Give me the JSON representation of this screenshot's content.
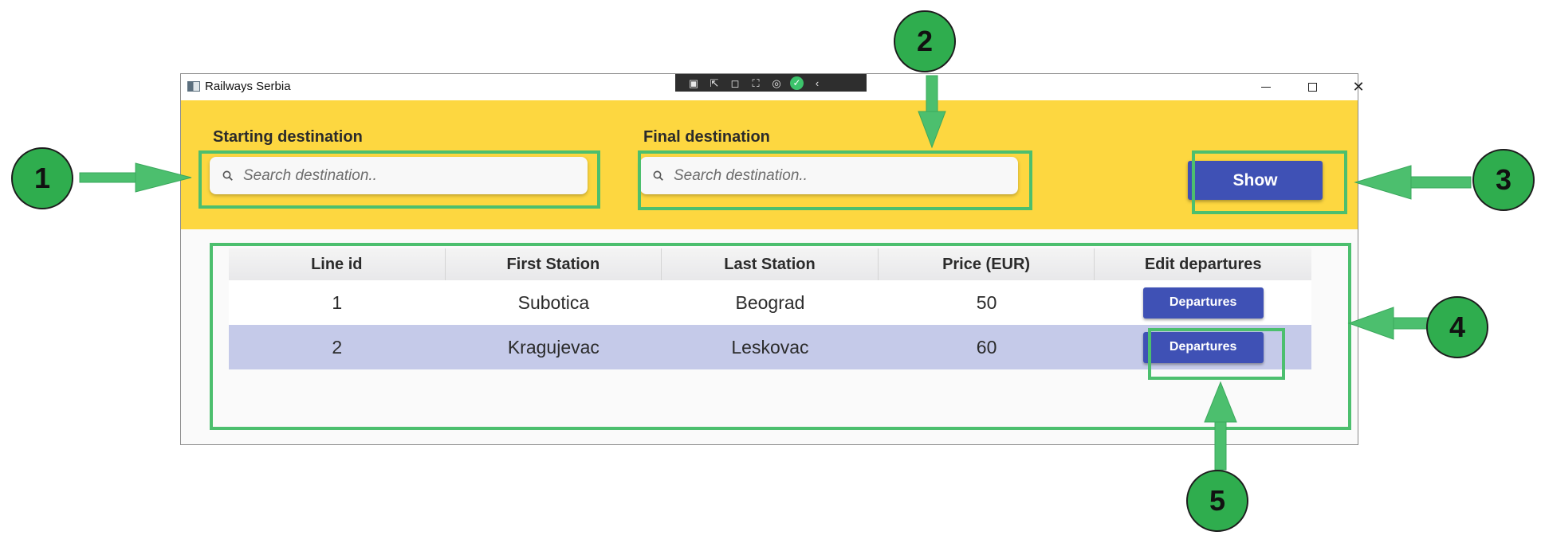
{
  "window": {
    "title": "Railways Serbia",
    "controls": {
      "minimize": "minimize",
      "maximize": "maximize",
      "close": "close"
    }
  },
  "devtools": {
    "icons": [
      "live-visual-tree-icon",
      "select-element-icon",
      "display-layout-adorners-icon",
      "track-focus-icon",
      "hot-reload-icon",
      "binding-ok-icon",
      "collapse-chevron-icon"
    ]
  },
  "header": {
    "starting_label": "Starting destination",
    "starting_placeholder": "Search destination..",
    "final_label": "Final destination",
    "final_placeholder": "Search destination..",
    "show_label": "Show"
  },
  "table": {
    "columns": [
      "Line id",
      "First Station",
      "Last Station",
      "Price (EUR)",
      "Edit departures"
    ],
    "rows": [
      {
        "id": "1",
        "first": "Subotica",
        "last": "Beograd",
        "price": "50",
        "action": "Departures"
      },
      {
        "id": "2",
        "first": "Kragujevac",
        "last": "Leskovac",
        "price": "60",
        "action": "Departures"
      }
    ]
  },
  "annotations": [
    "1",
    "2",
    "3",
    "4",
    "5"
  ],
  "colors": {
    "header_bg": "#fdd740",
    "primary_button": "#3f51b5",
    "selected_row": "#c5cae9",
    "annotation_green": "#2fad4e",
    "highlight_green": "#4cbf6e"
  }
}
